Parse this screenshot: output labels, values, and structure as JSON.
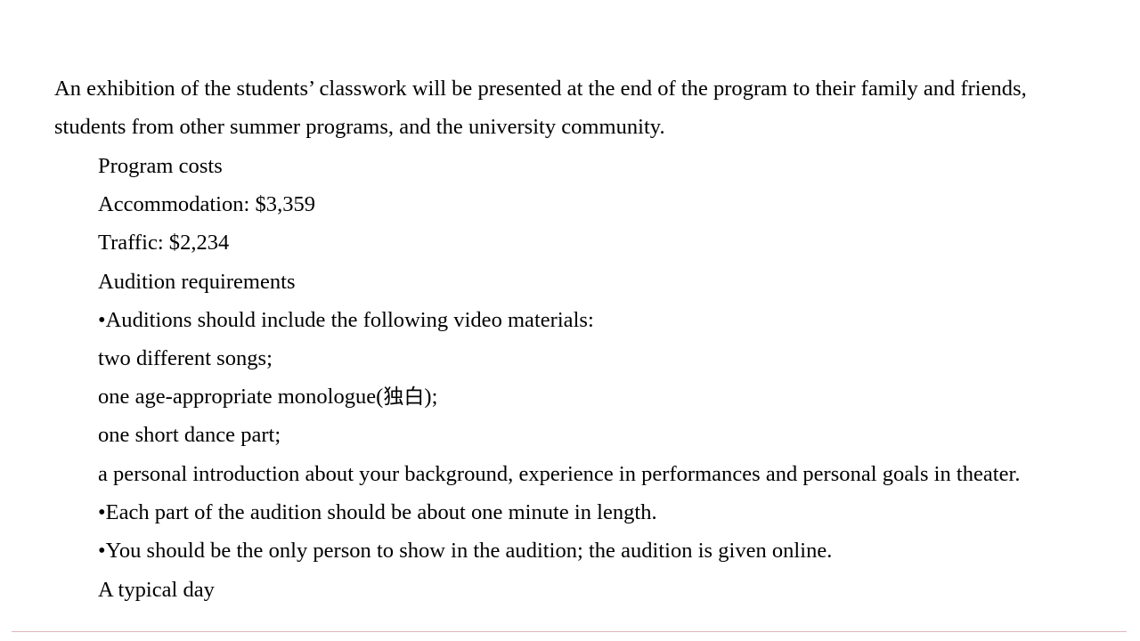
{
  "document": {
    "background_color": "#ffffff",
    "text_color": "#000000",
    "rule_color": "#e0b6bc",
    "body": {
      "paragraph": {
        "line_1": "An exhibition of the students’ classwork will be presented at the end of the program to their family and friends,",
        "line_2": "students from other summer programs, and the university community."
      },
      "sections": [
        {
          "heading": "Program costs",
          "items": [
            "Accommodation: $3,359",
            "Traffic: $2,234"
          ]
        },
        {
          "heading": "Audition requirements",
          "items": [
            "•Auditions should include the following video materials:",
            "two different songs;",
            "one age-appropriate monologue(",
            "独白",
            ");",
            "one short dance part;",
            "a personal introduction about your background, experience in performances and personal goals in theater.",
            "•Each part of the audition should be about one minute in length.",
            "•You should be the only person to show in the audition; the audition is given online."
          ]
        },
        {
          "heading": "A typical day",
          "items": []
        }
      ],
      "lines": {
        "l01": "An exhibition of the students’ classwork will be presented at the end of the program to their family and friends,",
        "l02": "students from other summer programs, and the university community.",
        "l03": "Program costs",
        "l04": "Accommodation: $3,359",
        "l05": "Traffic: $2,234",
        "l06": "Audition requirements",
        "l07": "•Auditions should include the following video materials:",
        "l08": "two different songs;",
        "l09a": "one age-appropriate monologue(",
        "l09b": "独白",
        "l09c": ");",
        "l10": "one short dance part;",
        "l11": "a personal introduction about your background, experience in performances and personal goals in theater.",
        "l12": "•Each part of the audition should be about one minute in length.",
        "l13": "•You should be the only person to show in the audition; the audition is given online.",
        "l14": "A typical day"
      },
      "costs": {
        "accommodation_label": "Accommodation:",
        "accommodation_value": "$3,359",
        "traffic_label": "Traffic:",
        "traffic_value": "$2,234"
      }
    }
  }
}
